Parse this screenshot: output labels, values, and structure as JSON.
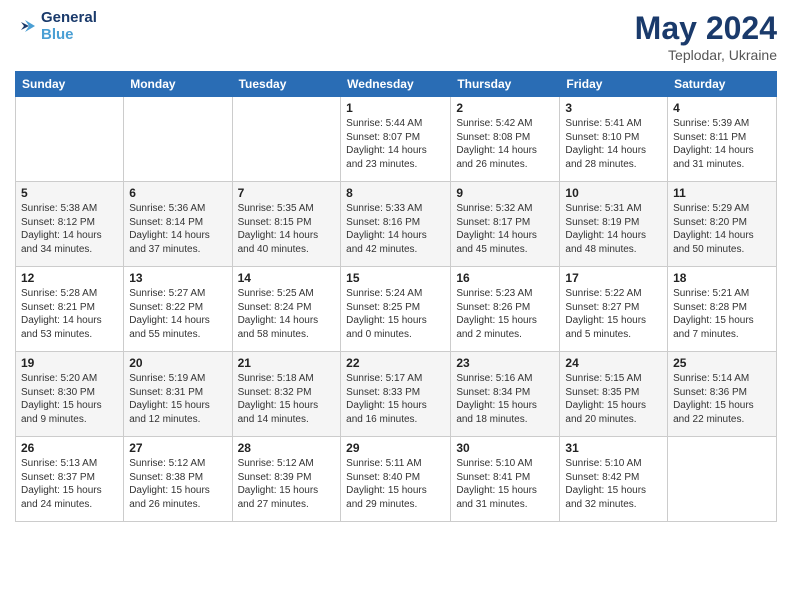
{
  "header": {
    "logo_line1": "General",
    "logo_line2": "Blue",
    "title": "May 2024",
    "location": "Teplodar, Ukraine"
  },
  "days_of_week": [
    "Sunday",
    "Monday",
    "Tuesday",
    "Wednesday",
    "Thursday",
    "Friday",
    "Saturday"
  ],
  "weeks": [
    [
      {
        "day": "",
        "sunrise": "",
        "sunset": "",
        "daylight": ""
      },
      {
        "day": "",
        "sunrise": "",
        "sunset": "",
        "daylight": ""
      },
      {
        "day": "",
        "sunrise": "",
        "sunset": "",
        "daylight": ""
      },
      {
        "day": "1",
        "sunrise": "Sunrise: 5:44 AM",
        "sunset": "Sunset: 8:07 PM",
        "daylight": "Daylight: 14 hours and 23 minutes."
      },
      {
        "day": "2",
        "sunrise": "Sunrise: 5:42 AM",
        "sunset": "Sunset: 8:08 PM",
        "daylight": "Daylight: 14 hours and 26 minutes."
      },
      {
        "day": "3",
        "sunrise": "Sunrise: 5:41 AM",
        "sunset": "Sunset: 8:10 PM",
        "daylight": "Daylight: 14 hours and 28 minutes."
      },
      {
        "day": "4",
        "sunrise": "Sunrise: 5:39 AM",
        "sunset": "Sunset: 8:11 PM",
        "daylight": "Daylight: 14 hours and 31 minutes."
      }
    ],
    [
      {
        "day": "5",
        "sunrise": "Sunrise: 5:38 AM",
        "sunset": "Sunset: 8:12 PM",
        "daylight": "Daylight: 14 hours and 34 minutes."
      },
      {
        "day": "6",
        "sunrise": "Sunrise: 5:36 AM",
        "sunset": "Sunset: 8:14 PM",
        "daylight": "Daylight: 14 hours and 37 minutes."
      },
      {
        "day": "7",
        "sunrise": "Sunrise: 5:35 AM",
        "sunset": "Sunset: 8:15 PM",
        "daylight": "Daylight: 14 hours and 40 minutes."
      },
      {
        "day": "8",
        "sunrise": "Sunrise: 5:33 AM",
        "sunset": "Sunset: 8:16 PM",
        "daylight": "Daylight: 14 hours and 42 minutes."
      },
      {
        "day": "9",
        "sunrise": "Sunrise: 5:32 AM",
        "sunset": "Sunset: 8:17 PM",
        "daylight": "Daylight: 14 hours and 45 minutes."
      },
      {
        "day": "10",
        "sunrise": "Sunrise: 5:31 AM",
        "sunset": "Sunset: 8:19 PM",
        "daylight": "Daylight: 14 hours and 48 minutes."
      },
      {
        "day": "11",
        "sunrise": "Sunrise: 5:29 AM",
        "sunset": "Sunset: 8:20 PM",
        "daylight": "Daylight: 14 hours and 50 minutes."
      }
    ],
    [
      {
        "day": "12",
        "sunrise": "Sunrise: 5:28 AM",
        "sunset": "Sunset: 8:21 PM",
        "daylight": "Daylight: 14 hours and 53 minutes."
      },
      {
        "day": "13",
        "sunrise": "Sunrise: 5:27 AM",
        "sunset": "Sunset: 8:22 PM",
        "daylight": "Daylight: 14 hours and 55 minutes."
      },
      {
        "day": "14",
        "sunrise": "Sunrise: 5:25 AM",
        "sunset": "Sunset: 8:24 PM",
        "daylight": "Daylight: 14 hours and 58 minutes."
      },
      {
        "day": "15",
        "sunrise": "Sunrise: 5:24 AM",
        "sunset": "Sunset: 8:25 PM",
        "daylight": "Daylight: 15 hours and 0 minutes."
      },
      {
        "day": "16",
        "sunrise": "Sunrise: 5:23 AM",
        "sunset": "Sunset: 8:26 PM",
        "daylight": "Daylight: 15 hours and 2 minutes."
      },
      {
        "day": "17",
        "sunrise": "Sunrise: 5:22 AM",
        "sunset": "Sunset: 8:27 PM",
        "daylight": "Daylight: 15 hours and 5 minutes."
      },
      {
        "day": "18",
        "sunrise": "Sunrise: 5:21 AM",
        "sunset": "Sunset: 8:28 PM",
        "daylight": "Daylight: 15 hours and 7 minutes."
      }
    ],
    [
      {
        "day": "19",
        "sunrise": "Sunrise: 5:20 AM",
        "sunset": "Sunset: 8:30 PM",
        "daylight": "Daylight: 15 hours and 9 minutes."
      },
      {
        "day": "20",
        "sunrise": "Sunrise: 5:19 AM",
        "sunset": "Sunset: 8:31 PM",
        "daylight": "Daylight: 15 hours and 12 minutes."
      },
      {
        "day": "21",
        "sunrise": "Sunrise: 5:18 AM",
        "sunset": "Sunset: 8:32 PM",
        "daylight": "Daylight: 15 hours and 14 minutes."
      },
      {
        "day": "22",
        "sunrise": "Sunrise: 5:17 AM",
        "sunset": "Sunset: 8:33 PM",
        "daylight": "Daylight: 15 hours and 16 minutes."
      },
      {
        "day": "23",
        "sunrise": "Sunrise: 5:16 AM",
        "sunset": "Sunset: 8:34 PM",
        "daylight": "Daylight: 15 hours and 18 minutes."
      },
      {
        "day": "24",
        "sunrise": "Sunrise: 5:15 AM",
        "sunset": "Sunset: 8:35 PM",
        "daylight": "Daylight: 15 hours and 20 minutes."
      },
      {
        "day": "25",
        "sunrise": "Sunrise: 5:14 AM",
        "sunset": "Sunset: 8:36 PM",
        "daylight": "Daylight: 15 hours and 22 minutes."
      }
    ],
    [
      {
        "day": "26",
        "sunrise": "Sunrise: 5:13 AM",
        "sunset": "Sunset: 8:37 PM",
        "daylight": "Daylight: 15 hours and 24 minutes."
      },
      {
        "day": "27",
        "sunrise": "Sunrise: 5:12 AM",
        "sunset": "Sunset: 8:38 PM",
        "daylight": "Daylight: 15 hours and 26 minutes."
      },
      {
        "day": "28",
        "sunrise": "Sunrise: 5:12 AM",
        "sunset": "Sunset: 8:39 PM",
        "daylight": "Daylight: 15 hours and 27 minutes."
      },
      {
        "day": "29",
        "sunrise": "Sunrise: 5:11 AM",
        "sunset": "Sunset: 8:40 PM",
        "daylight": "Daylight: 15 hours and 29 minutes."
      },
      {
        "day": "30",
        "sunrise": "Sunrise: 5:10 AM",
        "sunset": "Sunset: 8:41 PM",
        "daylight": "Daylight: 15 hours and 31 minutes."
      },
      {
        "day": "31",
        "sunrise": "Sunrise: 5:10 AM",
        "sunset": "Sunset: 8:42 PM",
        "daylight": "Daylight: 15 hours and 32 minutes."
      },
      {
        "day": "",
        "sunrise": "",
        "sunset": "",
        "daylight": ""
      }
    ]
  ]
}
